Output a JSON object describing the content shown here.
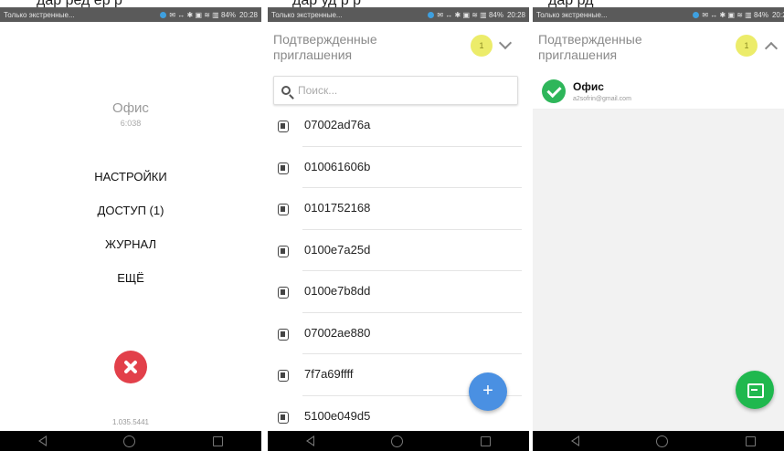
{
  "top_strip": [
    "дар  ред  ер  р",
    "дар  уд  р  р",
    "дар  рд"
  ],
  "statusbar": {
    "carrier": "Только экстренные...",
    "icons": "✉ ↔ ✱ ▣ ≋ ▥ 84%",
    "battery_pct": "84%",
    "time": "20:28"
  },
  "screen1": {
    "title": "Офис",
    "subtitle": "6:038",
    "menu": [
      "НАСТРОЙКИ",
      "ДОСТУП (1)",
      "ЖУРНАЛ",
      "ЕЩЁ"
    ],
    "version": "1.035.5441"
  },
  "screen2": {
    "title": "Подтвержденные приглашения",
    "badge": "1",
    "search_placeholder": "Поиск...",
    "devices": [
      "07002ad76a",
      "010061606b",
      "0101752168",
      "0100e7a25d",
      "0100e7b8dd",
      "07002ae880",
      "7f7a69ffff",
      "5100e049d5"
    ],
    "fab_label": "+"
  },
  "screen3": {
    "title": "Подтвержденные приглашения",
    "badge": "1",
    "invite_name": "Офис",
    "invite_email": "a2sofrin@gmail.com"
  },
  "colors": {
    "statusbar": "#5a5a5a",
    "badge": "#ecec6a",
    "close": "#e2404a",
    "fab_blue": "#4a90e2",
    "fab_green": "#1fb84e",
    "check": "#2eb65a"
  }
}
